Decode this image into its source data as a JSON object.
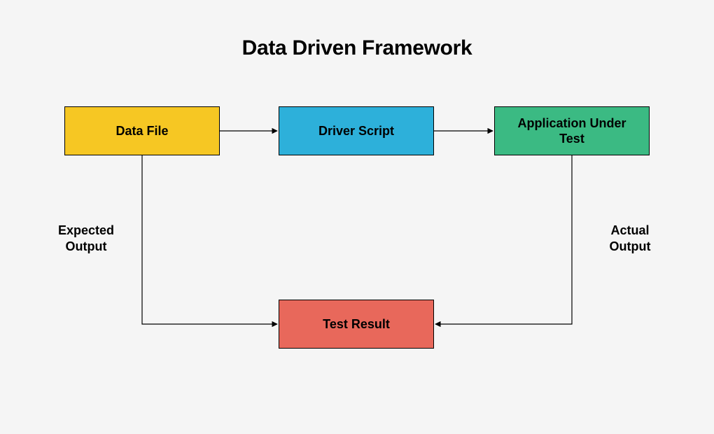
{
  "title": "Data Driven Framework",
  "nodes": {
    "data_file": "Data File",
    "driver_script": "Driver Script",
    "app_under_test": "Application Under\nTest",
    "test_result": "Test Result"
  },
  "edges": {
    "expected_output": "Expected\nOutput",
    "actual_output": "Actual\nOutput"
  },
  "colors": {
    "data_file": "#f6c723",
    "driver_script": "#2db0da",
    "app_under_test": "#3bba83",
    "test_result": "#e8685b"
  }
}
